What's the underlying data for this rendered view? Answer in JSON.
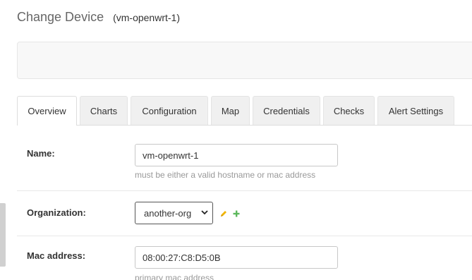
{
  "header": {
    "title": "Change Device",
    "subtitle": "(vm-openwrt-1)"
  },
  "tabs": [
    {
      "label": "Overview",
      "active": true
    },
    {
      "label": "Charts",
      "active": false
    },
    {
      "label": "Configuration",
      "active": false
    },
    {
      "label": "Map",
      "active": false
    },
    {
      "label": "Credentials",
      "active": false
    },
    {
      "label": "Checks",
      "active": false
    },
    {
      "label": "Alert Settings",
      "active": false
    }
  ],
  "form": {
    "name": {
      "label": "Name:",
      "value": "vm-openwrt-1",
      "help": "must be either a valid hostname or mac address"
    },
    "organization": {
      "label": "Organization:",
      "selected": "another-org",
      "change_icon": "pencil-icon",
      "add_icon": "plus-icon"
    },
    "mac_address": {
      "label": "Mac address:",
      "value": "08:00:27:C8:D5:0B",
      "help": "primary mac address"
    }
  },
  "colors": {
    "change_icon": "#f0b400",
    "add_icon": "#5cb85c"
  }
}
